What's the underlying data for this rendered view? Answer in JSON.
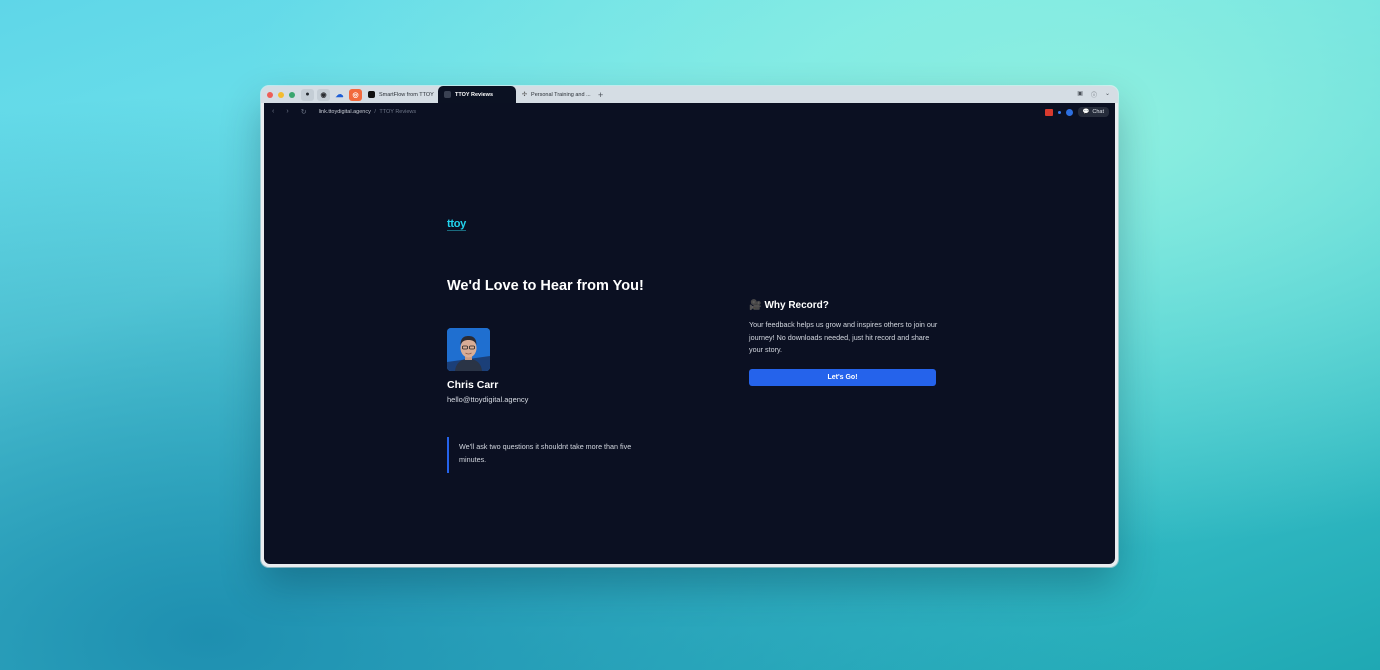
{
  "browser": {
    "tabs": [
      {
        "label": "SmartFlow from TTOY"
      },
      {
        "label": "TTOY Reviews"
      },
      {
        "label": "Personal Training and ..."
      }
    ],
    "new_tab_icon": "plus-icon",
    "address": {
      "host": "link.ttoydigital.agency",
      "separator": "/",
      "page_title": "TTOY Reviews"
    },
    "chat_label": "Chat"
  },
  "page": {
    "logo_text": "ttoy",
    "headline": "We'd Love to Hear from You!",
    "contact": {
      "name": "Chris Carr",
      "email": "hello@ttoydigital.agency"
    },
    "note": "We'll ask two questions it shouldnt take more than five minutes.",
    "why": {
      "title": "Why Record?",
      "icon": "film-icon",
      "body": "Your feedback helps us grow and inspires others to join our journey! No downloads needed, just hit record and share your story."
    },
    "cta_label": "Let's Go!"
  },
  "colors": {
    "page_bg": "#0b1022",
    "accent": "#2563eb",
    "logo": "#22d3ee"
  }
}
